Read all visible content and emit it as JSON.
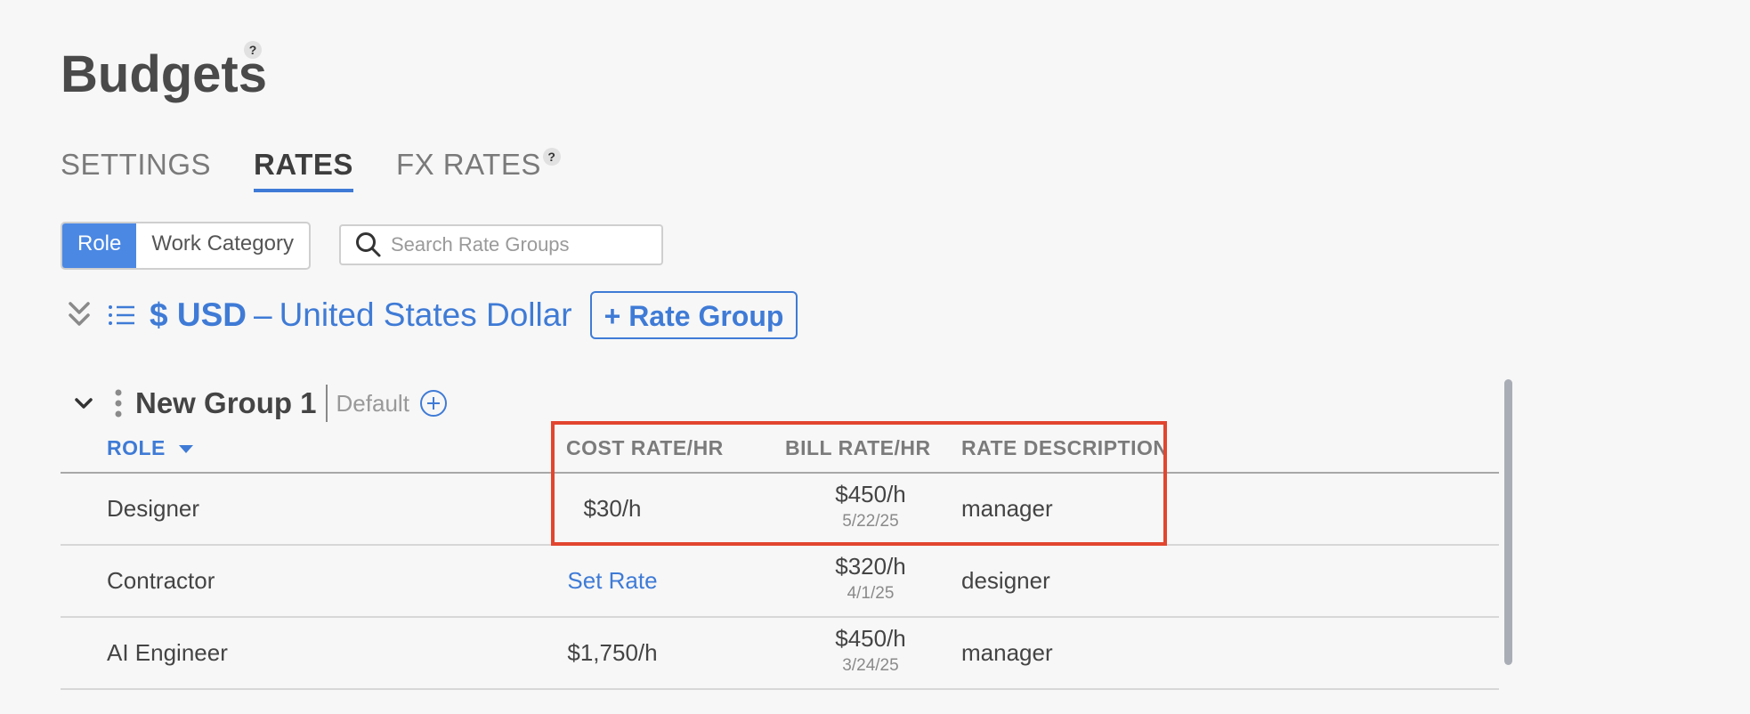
{
  "header": {
    "title": "Budgets",
    "help": "?"
  },
  "tabs": [
    {
      "label": "SETTINGS",
      "active": false
    },
    {
      "label": "RATES",
      "active": true
    },
    {
      "label": "FX RATES",
      "active": false,
      "help": "?"
    }
  ],
  "toggle": {
    "options": [
      "Role",
      "Work Category"
    ],
    "selected": "Role"
  },
  "search": {
    "placeholder": "Search Rate Groups",
    "value": ""
  },
  "currency": {
    "code": "$ USD",
    "dash": "–",
    "name": "United States Dollar",
    "add_label": "+ Rate Group"
  },
  "group": {
    "name": "New Group 1",
    "default_label": "Default"
  },
  "table": {
    "headers": {
      "role": "ROLE",
      "cost": "COST RATE/HR",
      "bill": "BILL RATE/HR",
      "desc": "RATE DESCRIPTION"
    },
    "rows": [
      {
        "role": "Designer",
        "cost": "$30/h",
        "bill": "$450/h",
        "bill_date": "5/22/25",
        "desc": "manager"
      },
      {
        "role": "Contractor",
        "cost": "Set Rate",
        "bill": "$320/h",
        "bill_date": "4/1/25",
        "desc": "designer"
      },
      {
        "role": "AI Engineer",
        "cost": "$1,750/h",
        "bill": "$450/h",
        "bill_date": "3/24/25",
        "desc": "manager"
      }
    ]
  },
  "colors": {
    "accent": "#3f7bd6",
    "toggle_active": "#4b88e3",
    "highlight": "#e2452f",
    "background": "#f7f7f7"
  },
  "icons": [
    "help-icon",
    "search-icon",
    "collapse-all-icon",
    "list-icon",
    "chevron-down-icon",
    "more-vertical-icon",
    "add-circle-icon",
    "sort-down-icon"
  ]
}
